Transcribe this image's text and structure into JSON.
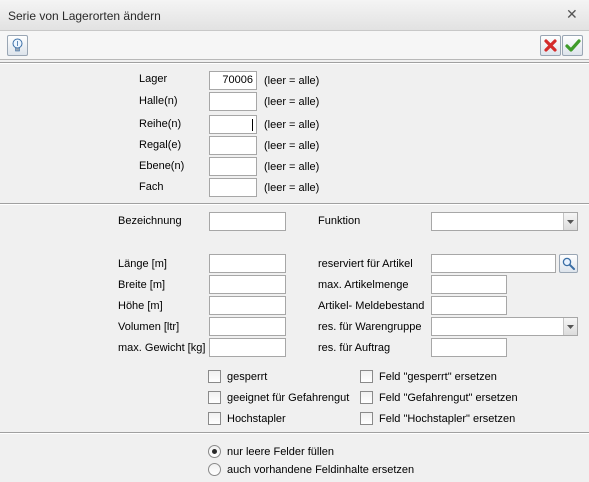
{
  "window": {
    "title": "Serie von Lagerorten ändern"
  },
  "icons": {
    "close": "close-icon",
    "hint": "lightbulb-icon",
    "cancel": "red-x-icon",
    "ok": "green-check-icon",
    "search": "magnifier-icon",
    "dropdown": "chevron-down-icon"
  },
  "colors": {
    "cancel": "#d42b2b",
    "ok": "#3f9c2b"
  },
  "location": {
    "lager": {
      "label": "Lager",
      "value": "70006",
      "hint": "(leer = alle)"
    },
    "halle": {
      "label": "Halle(n)",
      "value": "",
      "hint": "(leer = alle)"
    },
    "reihe": {
      "label": "Reihe(n)",
      "value": "",
      "hint": "(leer = alle)"
    },
    "regal": {
      "label": "Regal(e)",
      "value": "",
      "hint": "(leer = alle)"
    },
    "ebene": {
      "label": "Ebene(n)",
      "value": "",
      "hint": "(leer = alle)"
    },
    "fach": {
      "label": "Fach",
      "value": "",
      "hint": "(leer = alle)"
    }
  },
  "props": {
    "bezeichnung": {
      "label": "Bezeichnung",
      "value": ""
    },
    "funktion": {
      "label": "Funktion",
      "value": ""
    },
    "laenge": {
      "label": "Länge [m]",
      "value": ""
    },
    "breite": {
      "label": "Breite [m]",
      "value": ""
    },
    "hoehe": {
      "label": "Höhe [m]",
      "value": ""
    },
    "volumen": {
      "label": "Volumen [ltr]",
      "value": ""
    },
    "gewicht": {
      "label": "max. Gewicht [kg]",
      "value": ""
    },
    "artikel": {
      "label": "reserviert für Artikel",
      "value": ""
    },
    "artikelmenge": {
      "label": "max. Artikelmenge",
      "value": ""
    },
    "meldebestand": {
      "label": "Artikel- Meldebestand",
      "value": ""
    },
    "warengruppe": {
      "label": "res. für Warengruppe",
      "value": ""
    },
    "auftrag": {
      "label": "res. für Auftrag",
      "value": ""
    }
  },
  "flags": {
    "gesperrt": {
      "label": "gesperrt",
      "checked": false
    },
    "gefahrengut": {
      "label": "geeignet für Gefahrengut",
      "checked": false
    },
    "hochstapler": {
      "label": "Hochstapler",
      "checked": false
    },
    "set_gesperrt": {
      "label": "Feld \"gesperrt\" ersetzen",
      "checked": false
    },
    "set_gefahrengut": {
      "label": "Feld \"Gefahrengut\" ersetzen",
      "checked": false
    },
    "set_hochstapler": {
      "label": "Feld \"Hochstapler\" ersetzen",
      "checked": false
    }
  },
  "mode": {
    "selected": "fill_empty",
    "fill_empty": {
      "label": "nur leere Felder füllen"
    },
    "replace_all": {
      "label": "auch vorhandene Feldinhalte ersetzen"
    }
  }
}
